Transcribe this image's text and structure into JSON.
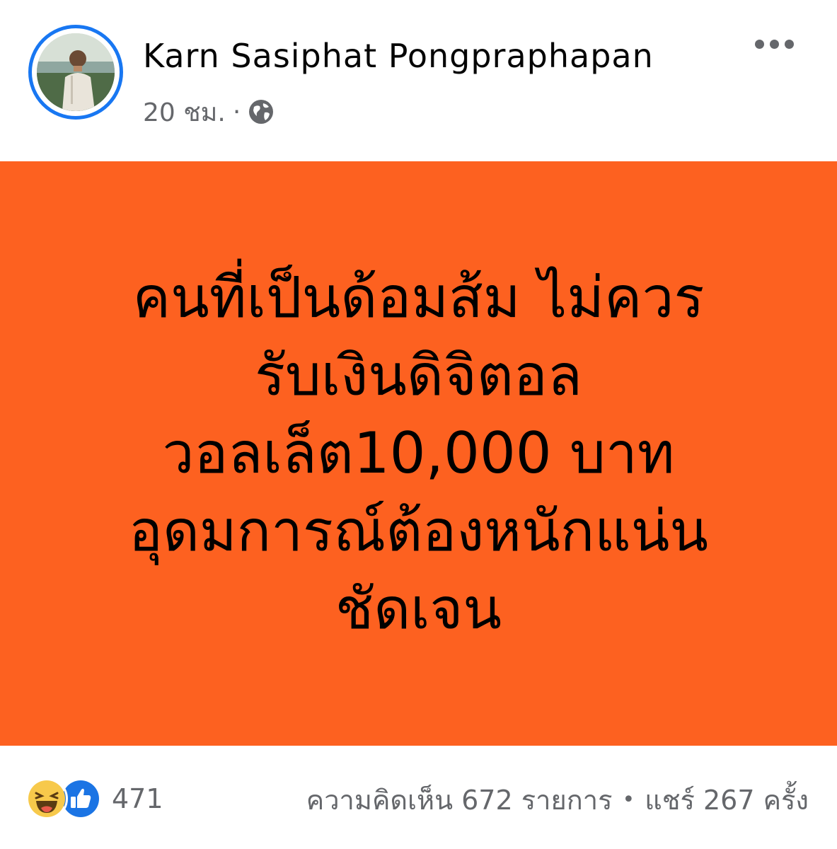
{
  "author": {
    "name": "Karn Sasiphat Pongpraphapan",
    "avatar_icon": "profile-photo"
  },
  "meta": {
    "time": "20 ชม.",
    "separator": "·",
    "privacy_icon": "globe-icon"
  },
  "post": {
    "background_color": "#fd6120",
    "text_color": "#000000",
    "lines": [
      "คนที่เป็นด้อมส้ม ไม่ควร",
      "รับเงินดิจิตอล",
      "วอลเล็ต10,000 บาท",
      "อุดมการณ์ต้องหนักแน่น",
      "ชัดเจน"
    ]
  },
  "reactions": {
    "icons": [
      "haha-reaction-icon",
      "like-reaction-icon"
    ],
    "count": "471"
  },
  "engagement": {
    "comments": "ความคิดเห็น 672 รายการ",
    "separator": "•",
    "shares": "แชร์ 267 ครั้ง"
  },
  "colors": {
    "accent": "#1877f2",
    "secondary_text": "#65676b"
  }
}
